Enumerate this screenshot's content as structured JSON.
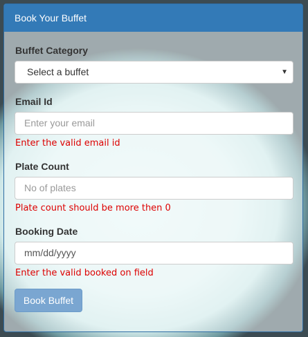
{
  "panel": {
    "title": "Book Your Buffet"
  },
  "form": {
    "buffet_category": {
      "label": "Buffet Category",
      "selected": "Select a buffet"
    },
    "email": {
      "label": "Email Id",
      "placeholder": "Enter your email",
      "error": "Enter the valid email id"
    },
    "plate_count": {
      "label": "Plate Count",
      "placeholder": "No of plates",
      "error": "Plate count should be more then 0"
    },
    "booking_date": {
      "label": "Booking Date",
      "placeholder": "mm/dd/yyyy",
      "error": "Enter the valid booked on field"
    },
    "submit_label": "Book Buffet"
  },
  "colors": {
    "header": "#337ab7",
    "error": "#dd0000",
    "button": "#7aa6d1"
  }
}
